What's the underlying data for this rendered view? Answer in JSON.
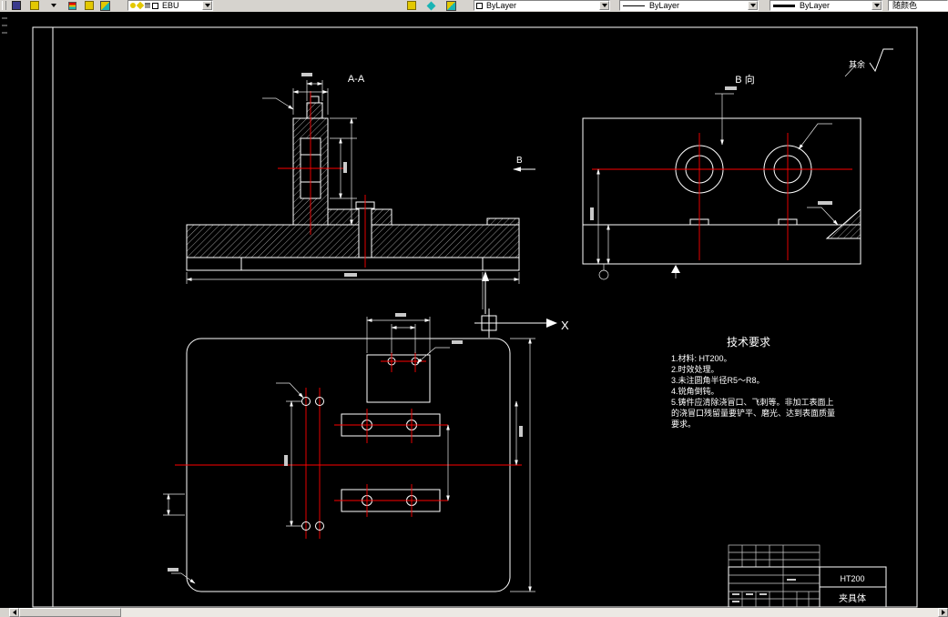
{
  "toolbar": {
    "layer_combo": {
      "layer_name": "EBU"
    },
    "color_combo": {
      "value": "ByLayer"
    },
    "linetype_combo": {
      "value": "ByLayer"
    },
    "lineweight_combo": {
      "value": "ByLayer"
    },
    "plot_style_combo": {
      "value": "随颜色"
    }
  },
  "drawing": {
    "section_view_label": "A-A",
    "b_view_label": "B 向",
    "b_direction_arrow_label": "B",
    "surface_finish_note": "其余",
    "ucs_x_axis_label": "X",
    "tech_requirements": {
      "title": "技术要求",
      "lines": [
        "1.材料: HT200。",
        "2.时效处理。",
        "3.未注圆角半径R5～R8。",
        "4.锐角倒钝。",
        "5.铸件应清除浇冒口、飞刺等。非加工表面上",
        "的浇冒口残留量要铲平、磨光、达到表面质量",
        "要求。"
      ]
    },
    "title_block": {
      "material": "HT200",
      "part_name": "夹具体"
    }
  },
  "colors": {
    "canvas_bg": "#000000",
    "line_color": "#ffffff",
    "centerline_color": "#ff0000",
    "toolbar_bg": "#d6d3ce",
    "accent_yellow": "#e3c800",
    "accent_cyan": "#19b4b4"
  }
}
